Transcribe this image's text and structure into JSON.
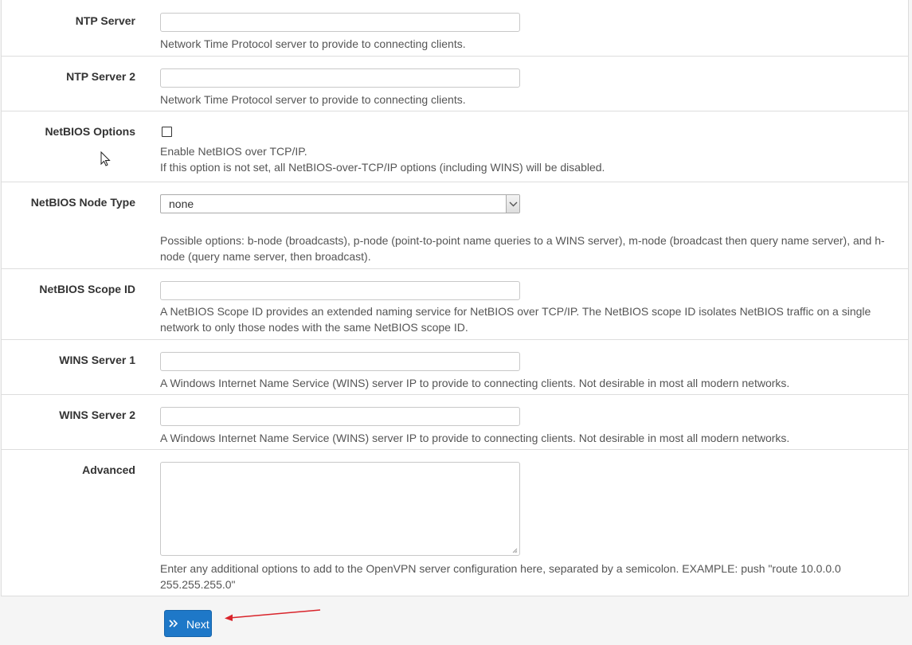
{
  "form": {
    "ntp_server": {
      "label": "NTP Server",
      "value": "",
      "help": "Network Time Protocol server to provide to connecting clients."
    },
    "ntp_server_2": {
      "label": "NTP Server 2",
      "value": "",
      "help": "Network Time Protocol server to provide to connecting clients."
    },
    "netbios_options": {
      "label": "NetBIOS Options",
      "checked": false,
      "help_1": "Enable NetBIOS over TCP/IP.",
      "help_2": "If this option is not set, all NetBIOS-over-TCP/IP options (including WINS) will be disabled."
    },
    "netbios_node_type": {
      "label": "NetBIOS Node Type",
      "selected": "none",
      "help": "Possible options: b-node (broadcasts), p-node (point-to-point name queries to a WINS server), m-node (broadcast then query name server), and h-node (query name server, then broadcast)."
    },
    "netbios_scope_id": {
      "label": "NetBIOS Scope ID",
      "value": "",
      "help": "A NetBIOS Scope ID provides an extended naming service for NetBIOS over TCP/IP. The NetBIOS scope ID isolates NetBIOS traffic on a single network to only those nodes with the same NetBIOS scope ID."
    },
    "wins_server_1": {
      "label": "WINS Server 1",
      "value": "",
      "help": "A Windows Internet Name Service (WINS) server IP to provide to connecting clients. Not desirable in most all modern networks."
    },
    "wins_server_2": {
      "label": "WINS Server 2",
      "value": "",
      "help": "A Windows Internet Name Service (WINS) server IP to provide to connecting clients. Not desirable in most all modern networks."
    },
    "advanced": {
      "label": "Advanced",
      "value": "",
      "help": "Enter any additional options to add to the OpenVPN server configuration here, separated by a semicolon. EXAMPLE: push \"route 10.0.0.0 255.255.255.0\""
    }
  },
  "actions": {
    "next_label": "Next",
    "next_icon": "double-chevron-right-icon"
  },
  "colors": {
    "primary_button": "#1e78c8",
    "annotation_arrow": "#d9242b"
  }
}
